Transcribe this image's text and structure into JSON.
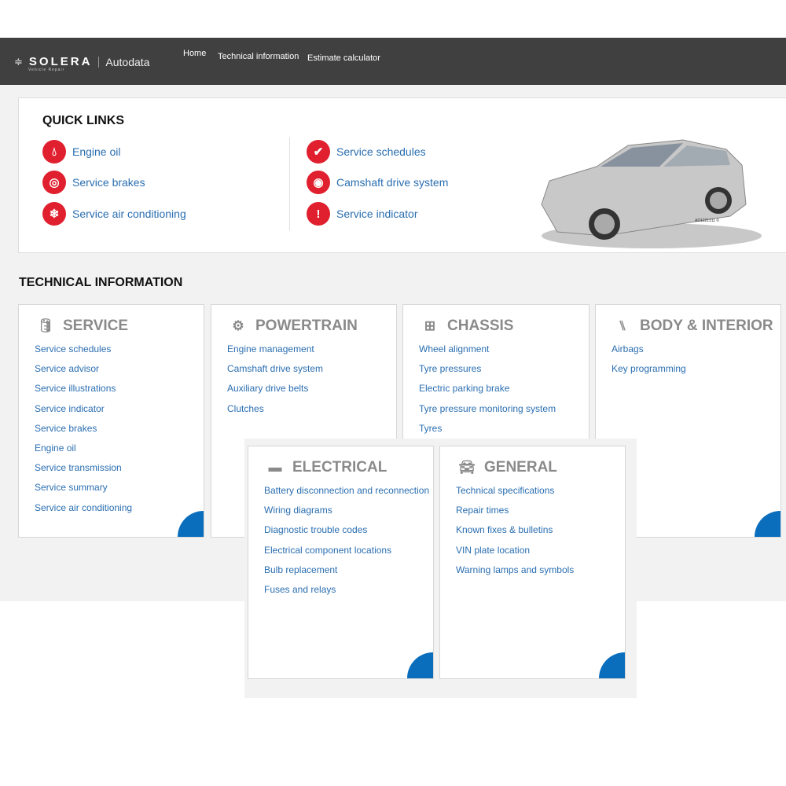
{
  "header": {
    "brand": "SOLERA",
    "brand_sub": "Vehicle Repair",
    "product": "Autodata",
    "nav": [
      "Home",
      "Technical information",
      "Estimate calculator"
    ]
  },
  "quick_links": {
    "title": "QUICK LINKS",
    "items": [
      {
        "label": "Engine oil",
        "icon": "oil-drop-icon"
      },
      {
        "label": "Service brakes",
        "icon": "brake-disc-icon"
      },
      {
        "label": "Service air conditioning",
        "icon": "snowflake-icon"
      },
      {
        "label": "Service schedules",
        "icon": "checkmark-icon"
      },
      {
        "label": "Camshaft drive system",
        "icon": "camshaft-belt-icon"
      },
      {
        "label": "Service indicator",
        "icon": "warning-icon"
      }
    ],
    "image_caption": "AD1221211 ©"
  },
  "technical_information": {
    "title": "TECHNICAL INFORMATION",
    "cards": [
      {
        "title": "SERVICE",
        "icon": "oil-can-icon",
        "links": [
          "Service schedules",
          "Service advisor",
          "Service illustrations",
          "Service indicator",
          "Service brakes",
          "Engine oil",
          "Service transmission",
          "Service summary",
          "Service air conditioning"
        ]
      },
      {
        "title": "POWERTRAIN",
        "icon": "engine-icon",
        "links": [
          "Engine management",
          "Camshaft drive system",
          "Auxiliary drive belts",
          "Clutches"
        ]
      },
      {
        "title": "CHASSIS",
        "icon": "chassis-icon",
        "links": [
          "Wheel alignment",
          "Tyre pressures",
          "Electric parking brake",
          "Tyre pressure monitoring system",
          "Tyres"
        ]
      },
      {
        "title": "BODY & INTERIOR",
        "icon": "seat-icon",
        "links": [
          "Airbags",
          "Key programming"
        ]
      },
      {
        "title": "ELECTRICAL",
        "icon": "battery-icon",
        "links": [
          "Battery disconnection and reconnection",
          "Wiring diagrams",
          "Diagnostic trouble codes",
          "Electrical component locations",
          "Bulb replacement",
          "Fuses and relays"
        ]
      },
      {
        "title": "GENERAL",
        "icon": "car-front-icon",
        "links": [
          "Technical specifications",
          "Repair times",
          "Known fixes & bulletins",
          "VIN plate location",
          "Warning lamps and symbols"
        ]
      }
    ]
  },
  "colors": {
    "header": "#404040",
    "accent": "#e0202e",
    "link": "#2a6eb0",
    "corner": "#0a6ebd"
  }
}
